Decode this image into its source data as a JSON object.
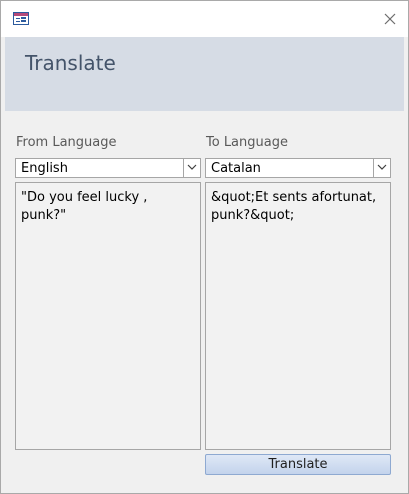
{
  "window": {
    "icon": "form-icon",
    "close_icon": "close-icon"
  },
  "form": {
    "title": "Translate"
  },
  "from": {
    "label": "From Language",
    "selected": "English",
    "text": "\"Do you feel lucky , punk?\""
  },
  "to": {
    "label": "To Language",
    "selected": "Catalan",
    "text": "&quot;Et sents afortunat, punk?&quot;"
  },
  "actions": {
    "translate_label": "Translate"
  },
  "colors": {
    "header_band": "#d6dce5",
    "title_text": "#44546a",
    "button_border": "#8ea9d1"
  }
}
